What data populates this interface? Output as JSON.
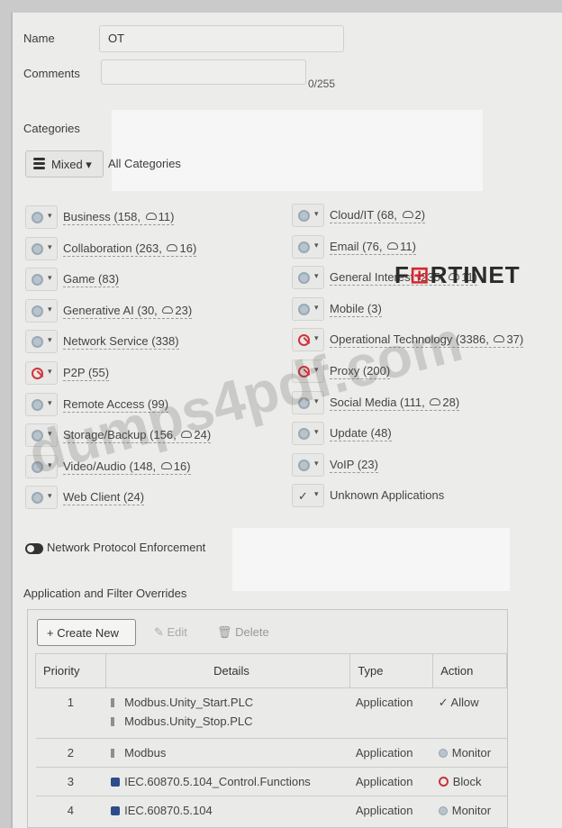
{
  "form": {
    "name_label": "Name",
    "name_value": "OT",
    "comments_label": "Comments",
    "comments_counter": "0/255"
  },
  "categories": {
    "heading": "Categories",
    "mixed_label": "Mixed",
    "all_label": "All Categories",
    "left": [
      {
        "name": "Business (158,",
        "cloud": "11)",
        "action": "monitor"
      },
      {
        "name": "Collaboration (263,",
        "cloud": "16)",
        "action": "monitor"
      },
      {
        "name": "Game (83)",
        "cloud": "",
        "action": "monitor"
      },
      {
        "name": "Generative AI (30,",
        "cloud": "23)",
        "action": "monitor"
      },
      {
        "name": "Network Service (338)",
        "cloud": "",
        "action": "monitor"
      },
      {
        "name": "P2P (55)",
        "cloud": "",
        "action": "block"
      },
      {
        "name": "Remote Access (99)",
        "cloud": "",
        "action": "monitor"
      },
      {
        "name": "Storage/Backup (156,",
        "cloud": "24)",
        "action": "monitor"
      },
      {
        "name": "Video/Audio (148,",
        "cloud": "16)",
        "action": "monitor"
      },
      {
        "name": "Web Client (24)",
        "cloud": "",
        "action": "monitor"
      }
    ],
    "right": [
      {
        "name": "Cloud/IT (68,",
        "cloud": "2)",
        "action": "monitor"
      },
      {
        "name": "Email (76,",
        "cloud": "11)",
        "action": "monitor"
      },
      {
        "name": "General Interest (235,",
        "cloud": "11)",
        "action": "monitor"
      },
      {
        "name": "Mobile (3)",
        "cloud": "",
        "action": "monitor"
      },
      {
        "name": "Operational Technology (3386,",
        "cloud": "37)",
        "action": "block"
      },
      {
        "name": "Proxy (200)",
        "cloud": "",
        "action": "block"
      },
      {
        "name": "Social Media (111,",
        "cloud": "28)",
        "action": "monitor"
      },
      {
        "name": "Update (48)",
        "cloud": "",
        "action": "monitor"
      },
      {
        "name": "VoIP (23)",
        "cloud": "",
        "action": "monitor"
      },
      {
        "name": "Unknown Applications",
        "cloud": "",
        "action": "allow",
        "plain": true
      }
    ]
  },
  "protocol_enforcement": {
    "label": "Network Protocol Enforcement"
  },
  "overrides": {
    "heading": "Application and Filter Overrides",
    "create_label": "+ Create New",
    "edit_label": "Edit",
    "delete_label": "Delete",
    "columns": [
      "Priority",
      "Details",
      "Type",
      "Action"
    ],
    "rows": [
      {
        "priority": "1",
        "details": [
          "Modbus.Unity_Start.PLC",
          "Modbus.Unity_Stop.PLC"
        ],
        "detail_icon": "app",
        "type": "Application",
        "action": "Allow",
        "action_icon": "allow"
      },
      {
        "priority": "2",
        "details": [
          "Modbus"
        ],
        "detail_icon": "app",
        "type": "Application",
        "action": "Monitor",
        "action_icon": "monitor"
      },
      {
        "priority": "3",
        "details": [
          "IEC.60870.5.104_Control.Functions"
        ],
        "detail_icon": "sig",
        "type": "Application",
        "action": "Block",
        "action_icon": "block"
      },
      {
        "priority": "4",
        "details": [
          "IEC.60870.5.104"
        ],
        "detail_icon": "sig",
        "type": "Application",
        "action": "Monitor",
        "action_icon": "monitor"
      }
    ]
  },
  "overlay": {
    "brand_pre": "F",
    "brand_red": "⊞",
    "brand_post": "RTINET",
    "watermark": "dumps4pdf.com"
  }
}
